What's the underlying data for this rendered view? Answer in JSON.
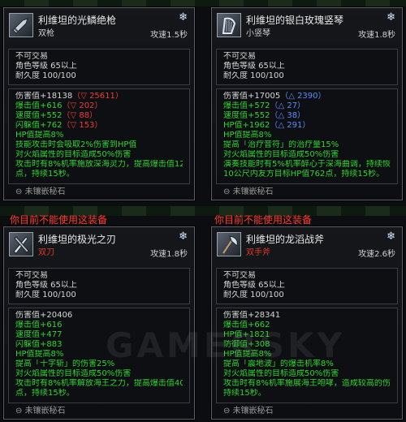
{
  "items": [
    {
      "name": "利维坦的光鳞绝枪",
      "type": "双枪",
      "speed": "攻速1.5秒",
      "base": [
        "不可交易",
        "角色等级 65以上",
        "耐久度 100/100"
      ],
      "stats": [
        {
          "label": "伤害值+18138",
          "cmp": "（▽ 25611）",
          "cmp_color": "red"
        },
        {
          "label": "爆击值+616",
          "cmp": "（▽ 202）",
          "cmp_color": "red"
        },
        {
          "label": "速度值+552",
          "cmp": "（▽ 88）",
          "cmp_color": "red"
        },
        {
          "label": "闪躲值+762",
          "cmp": "（▽ 153）",
          "cmp_color": "red"
        }
      ],
      "effects": [
        "HP值提高8%",
        "技能攻击时会吸取2%伤害到HP值",
        "对火焰属性的目标造成50%伤害",
        "攻击时有8%机率施放深海灵力，提高爆击值1251",
        "点，持续15秒。"
      ],
      "socket": "未镶嵌秘石"
    },
    {
      "name": "利维坦的银白玫瑰竖琴",
      "type": "小竖琴",
      "speed": "攻速1.8秒",
      "base": [
        "不可交易",
        "角色等级 65以上",
        "耐久度 100/100"
      ],
      "stats": [
        {
          "label": "伤害值+17005",
          "cmp": "（△ 2390）",
          "cmp_color": "blue"
        },
        {
          "label": "爆击值+572",
          "cmp": "（△ 27）",
          "cmp_color": "blue"
        },
        {
          "label": "速度值+552",
          "cmp": "（△ 38）",
          "cmp_color": "blue"
        },
        {
          "label": "HP值+1962",
          "cmp": "（△ 291）",
          "cmp_color": "blue"
        }
      ],
      "effects": [
        "HP值提高8%",
        "提高「治疗音符」的治疗量15%",
        "对火焰属性的目标造成50%伤害",
        "演奏技能时有5%机率醉心于深海曲调，持续恢复",
        "10公尺内友方目标HP值762点，持续15秒。"
      ],
      "socket": "未镶嵌秘石"
    },
    {
      "name": "利维坦的极光之刃",
      "type": "双刀",
      "speed": "攻速1.8秒",
      "cannot": "你目前不能使用这装备",
      "base": [
        "不可交易",
        "角色等级 65以上",
        "耐久度 100/100"
      ],
      "stats": [
        {
          "label": "伤害值+20406",
          "cmp": "",
          "cmp_color": "red"
        },
        {
          "label": "爆击值+616",
          "cmp": "",
          "cmp_color": "red"
        },
        {
          "label": "速度值+477",
          "cmp": "",
          "cmp_color": "red"
        },
        {
          "label": "闪躲值+883",
          "cmp": "",
          "cmp_color": "red"
        }
      ],
      "effects": [
        "HP值提高8%",
        "提高「十字斩」的伤害25%",
        "对火焰属性的目标造成50%伤害",
        "攻击时有8%机率解放海王之力，提高爆击值4066",
        "点，持续15秒。"
      ],
      "socket": "未镶嵌秘石"
    },
    {
      "name": "利维坦的龙滔战斧",
      "type": "双手斧",
      "speed": "攻速2.6秒",
      "cannot": "你目前不能使用这装备",
      "base": [
        "不可交易",
        "角色等级 65以上",
        "耐久度 100/100"
      ],
      "stats": [
        {
          "label": "伤害值+28341",
          "cmp": "",
          "cmp_color": "red"
        },
        {
          "label": "爆击值+662",
          "cmp": "",
          "cmp_color": "red"
        },
        {
          "label": "HP值+1821",
          "cmp": "",
          "cmp_color": "red"
        },
        {
          "label": "防御值+308",
          "cmp": "",
          "cmp_color": "red"
        }
      ],
      "effects": [
        "HP值提高8%",
        "提高「震地波」的爆击机率8%",
        "对火焰属性的目标造成50%伤害",
        "攻击时有8%机率施展海王咆哮，造成较高的伤害",
        "持续15秒。"
      ],
      "socket": "未镶嵌秘石"
    }
  ],
  "watermark": "GAMERSKY"
}
